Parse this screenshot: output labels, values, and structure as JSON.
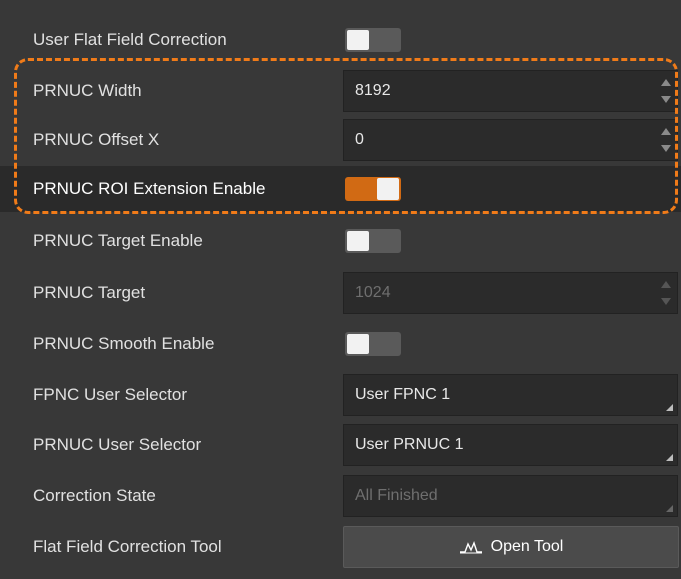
{
  "rows": [
    {
      "label": "User Flat Field Correction",
      "control": "toggle",
      "state": "off"
    },
    {
      "label": "PRNUC Width",
      "control": "spin",
      "value": "8192"
    },
    {
      "label": "PRNUC Offset X",
      "control": "spin",
      "value": "0"
    },
    {
      "label": "PRNUC ROI Extension Enable",
      "control": "toggle",
      "state": "on"
    },
    {
      "label": "PRNUC Target Enable",
      "control": "toggle",
      "state": "off"
    },
    {
      "label": "PRNUC Target",
      "control": "spin",
      "value": "1024",
      "disabled": true
    },
    {
      "label": "PRNUC Smooth Enable",
      "control": "toggle",
      "state": "off"
    },
    {
      "label": "FPNC User Selector",
      "control": "combo",
      "value": "User FPNC 1"
    },
    {
      "label": "PRNUC User Selector",
      "control": "combo",
      "value": "User PRNUC 1"
    },
    {
      "label": "Correction State",
      "control": "combo",
      "value": "All Finished",
      "disabled": true
    },
    {
      "label": "Flat Field Correction Tool",
      "control": "button",
      "button_label": "Open Tool",
      "icon": "waveform-icon"
    }
  ],
  "colors": {
    "panel_bg": "#383838",
    "accent_orange": "#d16a14",
    "highlight_border": "#f07b19"
  }
}
